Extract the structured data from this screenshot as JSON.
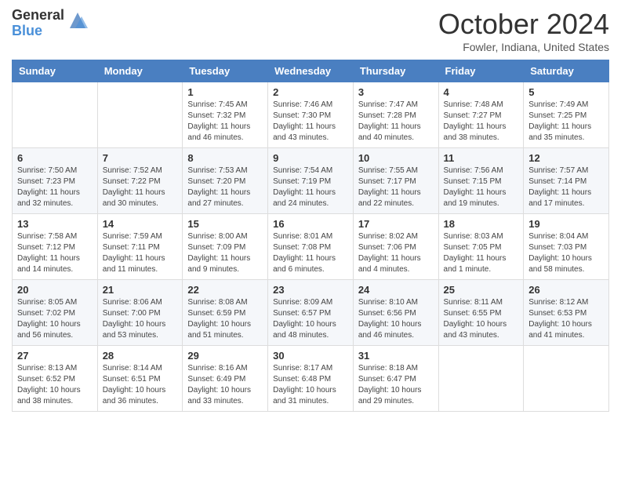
{
  "header": {
    "logo_general": "General",
    "logo_blue": "Blue",
    "month_title": "October 2024",
    "location": "Fowler, Indiana, United States"
  },
  "days_of_week": [
    "Sunday",
    "Monday",
    "Tuesday",
    "Wednesday",
    "Thursday",
    "Friday",
    "Saturday"
  ],
  "weeks": [
    [
      {
        "day": "",
        "info": ""
      },
      {
        "day": "",
        "info": ""
      },
      {
        "day": "1",
        "info": "Sunrise: 7:45 AM\nSunset: 7:32 PM\nDaylight: 11 hours and 46 minutes."
      },
      {
        "day": "2",
        "info": "Sunrise: 7:46 AM\nSunset: 7:30 PM\nDaylight: 11 hours and 43 minutes."
      },
      {
        "day": "3",
        "info": "Sunrise: 7:47 AM\nSunset: 7:28 PM\nDaylight: 11 hours and 40 minutes."
      },
      {
        "day": "4",
        "info": "Sunrise: 7:48 AM\nSunset: 7:27 PM\nDaylight: 11 hours and 38 minutes."
      },
      {
        "day": "5",
        "info": "Sunrise: 7:49 AM\nSunset: 7:25 PM\nDaylight: 11 hours and 35 minutes."
      }
    ],
    [
      {
        "day": "6",
        "info": "Sunrise: 7:50 AM\nSunset: 7:23 PM\nDaylight: 11 hours and 32 minutes."
      },
      {
        "day": "7",
        "info": "Sunrise: 7:52 AM\nSunset: 7:22 PM\nDaylight: 11 hours and 30 minutes."
      },
      {
        "day": "8",
        "info": "Sunrise: 7:53 AM\nSunset: 7:20 PM\nDaylight: 11 hours and 27 minutes."
      },
      {
        "day": "9",
        "info": "Sunrise: 7:54 AM\nSunset: 7:19 PM\nDaylight: 11 hours and 24 minutes."
      },
      {
        "day": "10",
        "info": "Sunrise: 7:55 AM\nSunset: 7:17 PM\nDaylight: 11 hours and 22 minutes."
      },
      {
        "day": "11",
        "info": "Sunrise: 7:56 AM\nSunset: 7:15 PM\nDaylight: 11 hours and 19 minutes."
      },
      {
        "day": "12",
        "info": "Sunrise: 7:57 AM\nSunset: 7:14 PM\nDaylight: 11 hours and 17 minutes."
      }
    ],
    [
      {
        "day": "13",
        "info": "Sunrise: 7:58 AM\nSunset: 7:12 PM\nDaylight: 11 hours and 14 minutes."
      },
      {
        "day": "14",
        "info": "Sunrise: 7:59 AM\nSunset: 7:11 PM\nDaylight: 11 hours and 11 minutes."
      },
      {
        "day": "15",
        "info": "Sunrise: 8:00 AM\nSunset: 7:09 PM\nDaylight: 11 hours and 9 minutes."
      },
      {
        "day": "16",
        "info": "Sunrise: 8:01 AM\nSunset: 7:08 PM\nDaylight: 11 hours and 6 minutes."
      },
      {
        "day": "17",
        "info": "Sunrise: 8:02 AM\nSunset: 7:06 PM\nDaylight: 11 hours and 4 minutes."
      },
      {
        "day": "18",
        "info": "Sunrise: 8:03 AM\nSunset: 7:05 PM\nDaylight: 11 hours and 1 minute."
      },
      {
        "day": "19",
        "info": "Sunrise: 8:04 AM\nSunset: 7:03 PM\nDaylight: 10 hours and 58 minutes."
      }
    ],
    [
      {
        "day": "20",
        "info": "Sunrise: 8:05 AM\nSunset: 7:02 PM\nDaylight: 10 hours and 56 minutes."
      },
      {
        "day": "21",
        "info": "Sunrise: 8:06 AM\nSunset: 7:00 PM\nDaylight: 10 hours and 53 minutes."
      },
      {
        "day": "22",
        "info": "Sunrise: 8:08 AM\nSunset: 6:59 PM\nDaylight: 10 hours and 51 minutes."
      },
      {
        "day": "23",
        "info": "Sunrise: 8:09 AM\nSunset: 6:57 PM\nDaylight: 10 hours and 48 minutes."
      },
      {
        "day": "24",
        "info": "Sunrise: 8:10 AM\nSunset: 6:56 PM\nDaylight: 10 hours and 46 minutes."
      },
      {
        "day": "25",
        "info": "Sunrise: 8:11 AM\nSunset: 6:55 PM\nDaylight: 10 hours and 43 minutes."
      },
      {
        "day": "26",
        "info": "Sunrise: 8:12 AM\nSunset: 6:53 PM\nDaylight: 10 hours and 41 minutes."
      }
    ],
    [
      {
        "day": "27",
        "info": "Sunrise: 8:13 AM\nSunset: 6:52 PM\nDaylight: 10 hours and 38 minutes."
      },
      {
        "day": "28",
        "info": "Sunrise: 8:14 AM\nSunset: 6:51 PM\nDaylight: 10 hours and 36 minutes."
      },
      {
        "day": "29",
        "info": "Sunrise: 8:16 AM\nSunset: 6:49 PM\nDaylight: 10 hours and 33 minutes."
      },
      {
        "day": "30",
        "info": "Sunrise: 8:17 AM\nSunset: 6:48 PM\nDaylight: 10 hours and 31 minutes."
      },
      {
        "day": "31",
        "info": "Sunrise: 8:18 AM\nSunset: 6:47 PM\nDaylight: 10 hours and 29 minutes."
      },
      {
        "day": "",
        "info": ""
      },
      {
        "day": "",
        "info": ""
      }
    ]
  ]
}
